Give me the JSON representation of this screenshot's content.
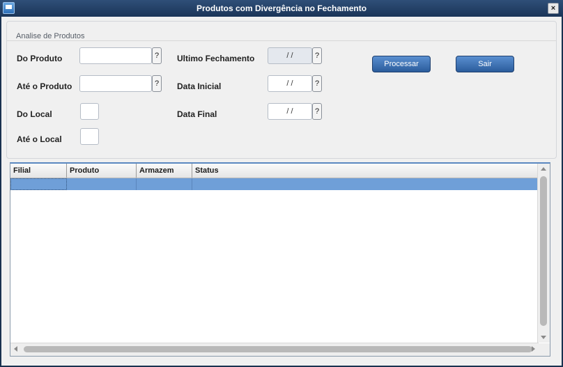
{
  "window": {
    "title": "Produtos com Divergência no Fechamento",
    "close_label": "×",
    "app_icon": "app-window-icon"
  },
  "group": {
    "title": "Analise de Produtos"
  },
  "form": {
    "do_produto": {
      "label": "Do Produto",
      "value": "",
      "help": "?"
    },
    "ate_produto": {
      "label": "Até o Produto",
      "value": "",
      "help": "?"
    },
    "do_local": {
      "label": "Do Local",
      "value": ""
    },
    "ate_local": {
      "label": "Até o Local",
      "value": ""
    },
    "ultimo_fechamento": {
      "label": "Ultimo Fechamento",
      "value": "/ /",
      "help": "?",
      "disabled": true
    },
    "data_inicial": {
      "label": "Data Inicial",
      "value": "/ /",
      "help": "?"
    },
    "data_final": {
      "label": "Data Final",
      "value": "/ /",
      "help": "?"
    }
  },
  "buttons": {
    "processar": "Processar",
    "sair": "Sair"
  },
  "grid": {
    "columns": [
      "Filial",
      "Produto",
      "Armazem",
      "Status"
    ],
    "rows": [
      {
        "filial": "",
        "produto": "",
        "armazem": "",
        "status": "",
        "selected": true
      }
    ]
  },
  "colors": {
    "titlebar": "#1a3458",
    "button": "#2b5c9c",
    "selected_row": "#6f9fd8"
  }
}
